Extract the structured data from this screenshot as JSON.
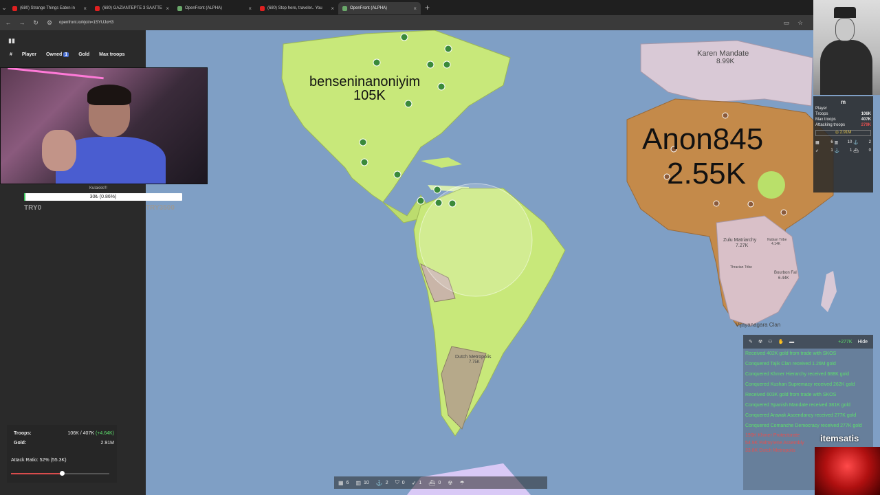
{
  "browser": {
    "tabs": [
      {
        "title": "(680) Strange Things Eaten in",
        "favicon_color": "#e02020"
      },
      {
        "title": "(680) GAZİANTEPTE 3 SAATTE",
        "favicon_color": "#e02020"
      },
      {
        "title": "OpenFront (ALPHA)",
        "favicon_color": "#6aa86a"
      },
      {
        "title": "(680) Stop here, traveler.. You",
        "favicon_color": "#e02020"
      },
      {
        "title": "OpenFront (ALPHA)",
        "favicon_color": "#6aa86a",
        "active": true
      }
    ],
    "url": "openfront.io/#join=1SYUJoH3"
  },
  "leaderboard": {
    "columns": [
      "#",
      "Player",
      "Owned",
      "Gold",
      "Max troops"
    ],
    "owned_badge": "1"
  },
  "donation": {
    "label": "Kulakkk!!!",
    "progress_text": "30₺ (0.86%)",
    "progress": 0.0086,
    "min": "TRY0",
    "max": "TRY3500"
  },
  "stats": {
    "troops_label": "Troops:",
    "troops_value": "106K / 407K",
    "troops_gain": "(+4.64K)",
    "gold_label": "Gold:",
    "gold_value": "2.91M",
    "attack_ratio": "Attack Ratio: 52% (55.3K)",
    "attack_ratio_fraction": 0.52
  },
  "map_labels": {
    "player1_name": "benseninanoniyim",
    "player1_troops": "105K",
    "player2_name": "Anon845",
    "player2_troops": "2.55K",
    "karen_name": "Karen Mandate",
    "karen_troops": "8.99K",
    "zulu_name": "Zulu Matriarchy",
    "zulu_troops": "7.27K",
    "nubian_name": "Nubian Tribe",
    "nubian_troops": "4.14K",
    "bourbon_name": "Bourbon Fal",
    "bourbon_troops": "6.44K",
    "thracian_name": "Thracian Tribe",
    "vijayanagara_name": "Vijayanagara Clan",
    "dutch_name": "Dutch Metropolis",
    "dutch_troops": "7.75K"
  },
  "bottombar": {
    "items": [
      {
        "icon": "city-icon",
        "value": "6"
      },
      {
        "icon": "factory-icon",
        "value": "10"
      },
      {
        "icon": "anchor-icon",
        "value": "2"
      },
      {
        "icon": "shield-icon",
        "value": "0"
      },
      {
        "icon": "missile-icon",
        "value": "1"
      },
      {
        "icon": "warship-icon",
        "value": "0"
      }
    ]
  },
  "player_card": {
    "name": "m",
    "type": "Player",
    "troops_label": "Troops",
    "troops": "106K",
    "max_troops_label": "Max troops",
    "max_troops": "407K",
    "attacking_label": "Attacking troops",
    "attacking": "279K",
    "gold": "2.91M",
    "grid": [
      {
        "icon": "city-icon",
        "value": "6"
      },
      {
        "icon": "factory-icon",
        "value": "10"
      },
      {
        "icon": "anchor-icon",
        "value": "2"
      },
      {
        "icon": "missile-icon",
        "value": "1"
      },
      {
        "icon": "port-icon",
        "value": "1"
      },
      {
        "icon": "warship-icon",
        "value": "0"
      }
    ]
  },
  "events": {
    "gain": "+277K",
    "hide_label": "Hide",
    "items": [
      "Received 402K gold from trade with SKOS",
      "Conquered Tajik Clan received 1.26M gold",
      "Conquered Khmer Hierarchy received 688K gold",
      "Conquered Kushan Supremacy received 262K gold",
      "Received 603K gold from trade with SKOS",
      "Conquered Spanish Mandate received 381K gold",
      "Conquered Arawak Ascendancy received 277K gold",
      "Conquered Comanche Democracy received 277K gold"
    ],
    "attacks": [
      "190K Khmer Protectorate",
      "54.9K Palmyrene Assembly",
      "33.8K Dutch Metropolis"
    ]
  },
  "watermark": "itemsatis",
  "colors": {
    "ocean": "#7f9fc5",
    "player_territory": "#c8e87a",
    "enemy_territory": "#c48a4a",
    "gain_green": "#5de06c",
    "danger_red": "#e45050"
  }
}
